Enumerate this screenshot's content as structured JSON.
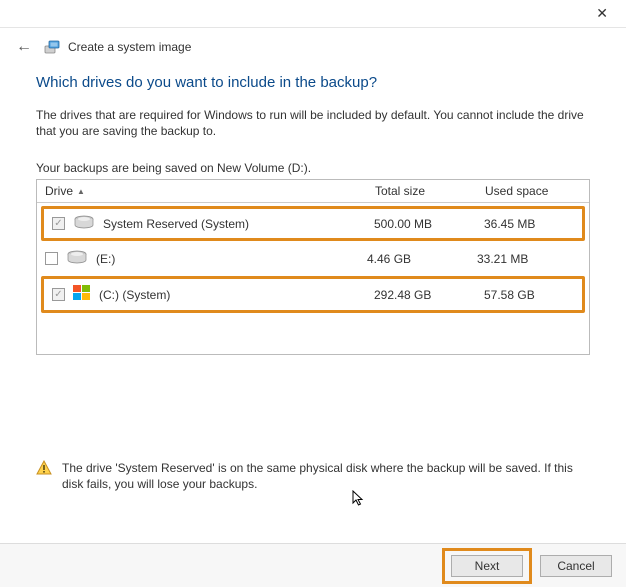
{
  "titlebar": {
    "close": "✕"
  },
  "header": {
    "back": "←",
    "title": "Create a system image"
  },
  "page": {
    "heading": "Which drives do you want to include in the backup?",
    "description": "The drives that are required for Windows to run will be included by default. You cannot include the drive that you are saving the backup to.",
    "save_location": "Your backups are being saved on New Volume (D:)."
  },
  "table": {
    "headers": {
      "drive": "Drive",
      "total": "Total size",
      "used": "Used space"
    },
    "rows": [
      {
        "checked": true,
        "disabled": true,
        "icon_type": "hdd",
        "name": "System Reserved (System)",
        "total": "500.00 MB",
        "used": "36.45 MB",
        "highlight": true
      },
      {
        "checked": false,
        "disabled": false,
        "icon_type": "hdd",
        "name": "(E:)",
        "total": "4.46 GB",
        "used": "33.21 MB",
        "highlight": false
      },
      {
        "checked": true,
        "disabled": true,
        "icon_type": "win",
        "name": "(C:) (System)",
        "total": "292.48 GB",
        "used": "57.58 GB",
        "highlight": true
      }
    ]
  },
  "warning": {
    "text": "The drive 'System Reserved' is on the same physical disk where the backup will be saved. If this disk fails, you will lose your backups."
  },
  "footer": {
    "next": "Next",
    "cancel": "Cancel"
  }
}
